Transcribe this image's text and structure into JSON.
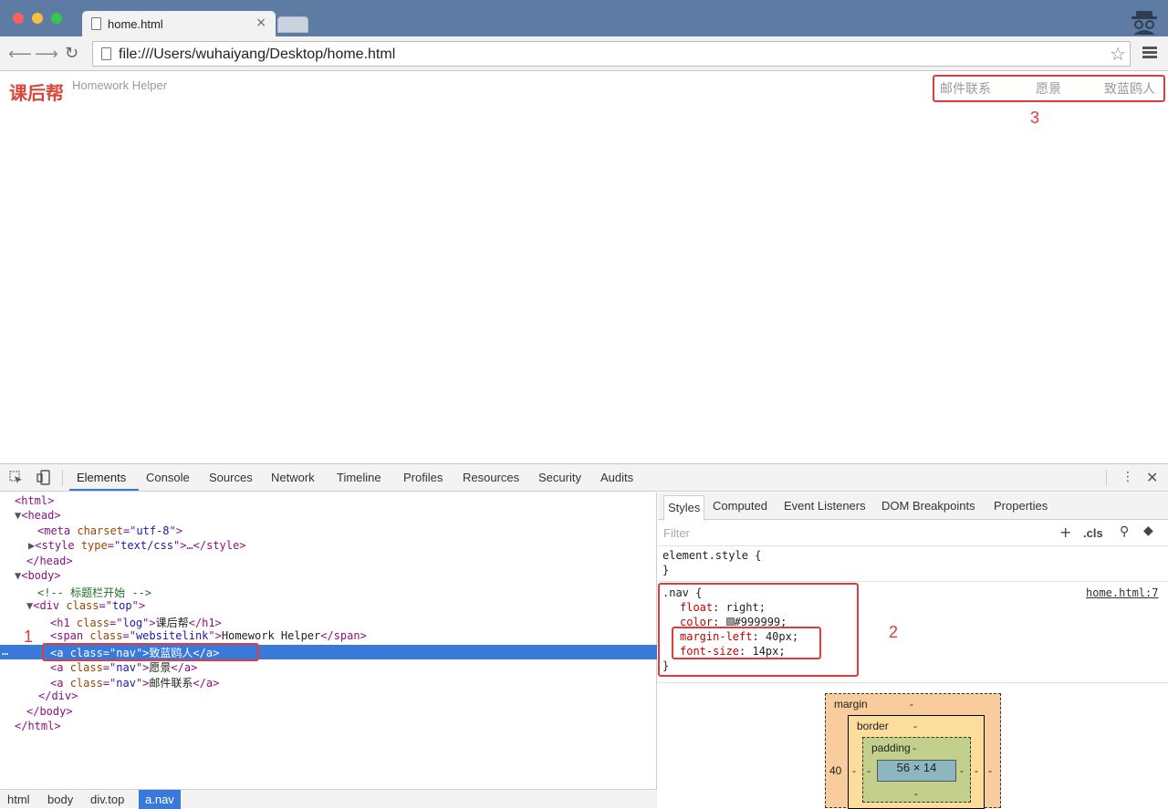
{
  "browser": {
    "tab_title": "home.html",
    "tab_close": "×",
    "url": "file:///Users/wuhaiyang/Desktop/home.html"
  },
  "page": {
    "logo": "课后帮",
    "website_link": "Homework Helper",
    "nav": [
      "邮件联系",
      "愿景",
      "致蓝鸥人"
    ]
  },
  "annotations": {
    "one": "1",
    "two": "2",
    "three": "3"
  },
  "devtools": {
    "tabs": [
      "Elements",
      "Console",
      "Sources",
      "Network",
      "Timeline",
      "Profiles",
      "Resources",
      "Security",
      "Audits"
    ],
    "dom": {
      "html_open": "<html>",
      "head_open": "<head>",
      "meta": [
        "<meta ",
        "charset",
        "=\"",
        "utf-8",
        "\">"
      ],
      "style": [
        "<style ",
        "type",
        "=\"",
        "text/css",
        "\">…</style>"
      ],
      "head_close": "</head>",
      "body_open": "<body>",
      "comment": "<!-- 标题栏开始 -->",
      "div": [
        "<div ",
        "class",
        "=\"",
        "top",
        "\">"
      ],
      "h1": [
        "<h1 ",
        "class",
        "=\"",
        "log",
        "\">",
        "课后帮",
        "</h1>"
      ],
      "span": [
        "<span ",
        "class",
        "=\"",
        "websitelink",
        "\">",
        "Homework Helper",
        "</span>"
      ],
      "a1": [
        "<a ",
        "class",
        "=\"",
        "nav",
        "\">",
        "致蓝鸥人",
        "</a>"
      ],
      "a2": [
        "<a ",
        "class",
        "=\"",
        "nav",
        "\">",
        "愿景",
        "</a>"
      ],
      "a3": [
        "<a ",
        "class",
        "=\"",
        "nav",
        "\">",
        "邮件联系",
        "</a>"
      ],
      "div_close": "</div>",
      "body_close": "</body>",
      "html_close": "</html>",
      "ellipsis": "…"
    },
    "breadcrumbs": [
      "html",
      "body",
      "div.top",
      "a.nav"
    ],
    "styles_tabs": [
      "Styles",
      "Computed",
      "Event Listeners",
      "DOM Breakpoints",
      "Properties"
    ],
    "filter_placeholder": "Filter",
    "cls_label": ".cls",
    "element_style": "element.style {",
    "close_brace": "}",
    "rule": {
      "selector": ".nav {",
      "source": "home.html:7",
      "props": [
        {
          "name": "float",
          "value": "right;"
        },
        {
          "name": "color",
          "value": "#999999;"
        },
        {
          "name": "margin-left",
          "value": "40px;"
        },
        {
          "name": "font-size",
          "value": "14px;"
        }
      ]
    },
    "box_model": {
      "margin_label": "margin",
      "border_label": "border",
      "padding_label": "padding",
      "content": "56 × 14",
      "dash": "-",
      "margin_left": "40"
    }
  },
  "colors": {
    "accent_red": "#e23b3b",
    "selection_blue": "#3879d9",
    "logo_red": "#d9483b"
  }
}
